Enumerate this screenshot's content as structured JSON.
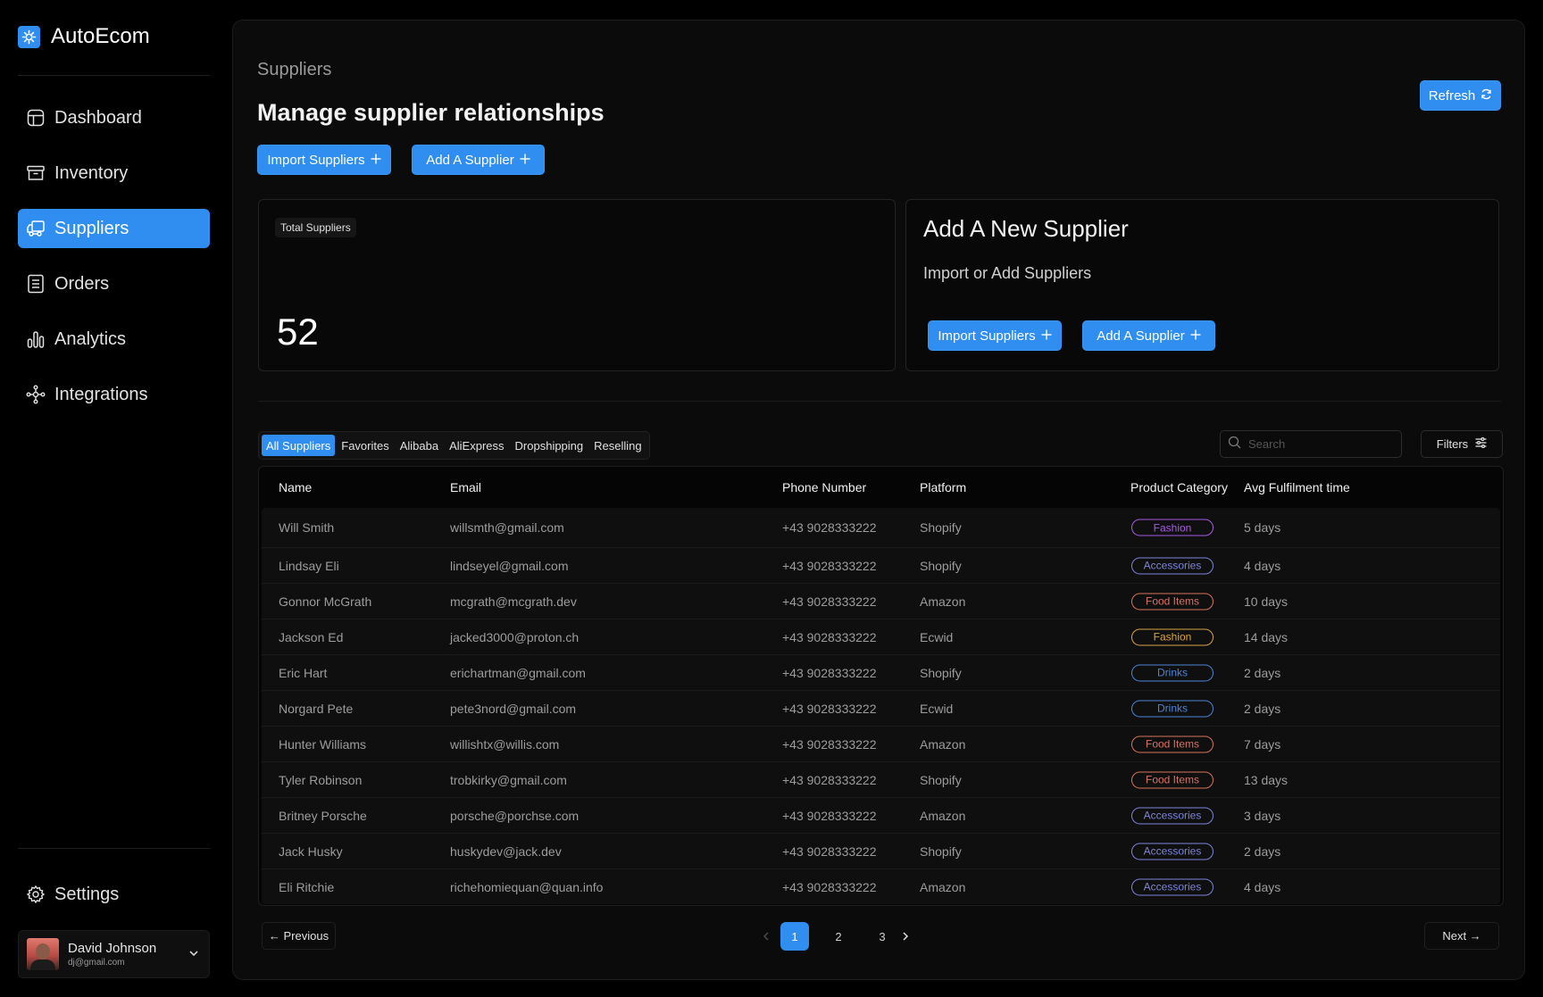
{
  "app": {
    "name": "AutoEcom"
  },
  "colors": {
    "accent": "#2f8ef0",
    "background": "#000000",
    "panel": "#0b0b0b"
  },
  "sidebar": {
    "items": [
      {
        "label": "Dashboard",
        "icon": "dashboard-icon",
        "active": false
      },
      {
        "label": "Inventory",
        "icon": "archive-box-icon",
        "active": false
      },
      {
        "label": "Suppliers",
        "icon": "truck-icon",
        "active": true
      },
      {
        "label": "Orders",
        "icon": "document-list-icon",
        "active": false
      },
      {
        "label": "Analytics",
        "icon": "bar-chart-icon",
        "active": false
      },
      {
        "label": "Integrations",
        "icon": "nodes-icon",
        "active": false
      }
    ],
    "settings_label": "Settings",
    "user": {
      "name": "David Johnson",
      "email": "dj@gmail.com"
    }
  },
  "header": {
    "breadcrumb": "Suppliers",
    "title": "Manage supplier relationships",
    "refresh_label": "Refresh",
    "import_label": "Import Suppliers",
    "add_label": "Add A Supplier"
  },
  "stats": {
    "label": "Total Suppliers",
    "value": "52"
  },
  "add_card": {
    "title": "Add A New Supplier",
    "subtitle": "Import or Add Suppliers",
    "import_label": "Import Suppliers",
    "add_label": "Add A Supplier"
  },
  "tabs": [
    "All Suppliers",
    "Favorites",
    "Alibaba",
    "AliExpress",
    "Dropshipping",
    "Reselling"
  ],
  "active_tab": "All Suppliers",
  "search": {
    "placeholder": "Search"
  },
  "filters_label": "Filters",
  "table": {
    "columns": [
      "Name",
      "Email",
      "Phone Number",
      "Platform",
      "Product Category",
      "Avg Fulfilment time"
    ],
    "rows": [
      {
        "name": "Will Smith",
        "email": "willsmth@gmail.com",
        "phone": "+43 9028333222",
        "platform": "Shopify",
        "category": "Fashion",
        "category_color": "#a45ee0",
        "time": "5 days"
      },
      {
        "name": "Lindsay Eli",
        "email": "lindseyel@gmail.com",
        "phone": "+43 9028333222",
        "platform": "Shopify",
        "category": "Accessories",
        "category_color": "#7d84d8",
        "time": "4 days"
      },
      {
        "name": "Gonnor McGrath",
        "email": "mcgrath@mcgrath.dev",
        "phone": "+43 9028333222",
        "platform": "Amazon",
        "category": "Food Items",
        "category_color": "#d9735f",
        "time": "10 days"
      },
      {
        "name": "Jackson Ed",
        "email": "jacked3000@proton.ch",
        "phone": "+43 9028333222",
        "platform": "Ecwid",
        "category": "Fashion",
        "category_color": "#d9a441",
        "time": "14 days"
      },
      {
        "name": "Eric Hart",
        "email": "erichartman@gmail.com",
        "phone": "+43 9028333222",
        "platform": "Shopify",
        "category": "Drinks",
        "category_color": "#4c83d6",
        "time": "2 days"
      },
      {
        "name": "Norgard Pete",
        "email": "pete3nord@gmail.com",
        "phone": "+43 9028333222",
        "platform": "Ecwid",
        "category": "Drinks",
        "category_color": "#4c83d6",
        "time": "2 days"
      },
      {
        "name": "Hunter Williams",
        "email": "willishtx@willis.com",
        "phone": "+43 9028333222",
        "platform": "Amazon",
        "category": "Food Items",
        "category_color": "#d9735f",
        "time": "7 days"
      },
      {
        "name": "Tyler Robinson",
        "email": "trobkirky@gmail.com",
        "phone": "+43 9028333222",
        "platform": "Shopify",
        "category": "Food Items",
        "category_color": "#d9735f",
        "time": "13 days"
      },
      {
        "name": "Britney Porsche",
        "email": "porsche@porchse.com",
        "phone": "+43 9028333222",
        "platform": "Amazon",
        "category": "Accessories",
        "category_color": "#7d84d8",
        "time": "3 days"
      },
      {
        "name": "Jack Husky",
        "email": "huskydev@jack.dev",
        "phone": "+43 9028333222",
        "platform": "Shopify",
        "category": "Accessories",
        "category_color": "#7d84d8",
        "time": "2 days"
      },
      {
        "name": "Eli Ritchie",
        "email": "richehomiequan@quan.info",
        "phone": "+43 9028333222",
        "platform": "Amazon",
        "category": "Accessories",
        "category_color": "#7d84d8",
        "time": "4 days"
      }
    ]
  },
  "pagination": {
    "previous_label": "← Previous",
    "next_label": "Next →",
    "pages": [
      "1",
      "2",
      "3"
    ],
    "current": "1"
  }
}
